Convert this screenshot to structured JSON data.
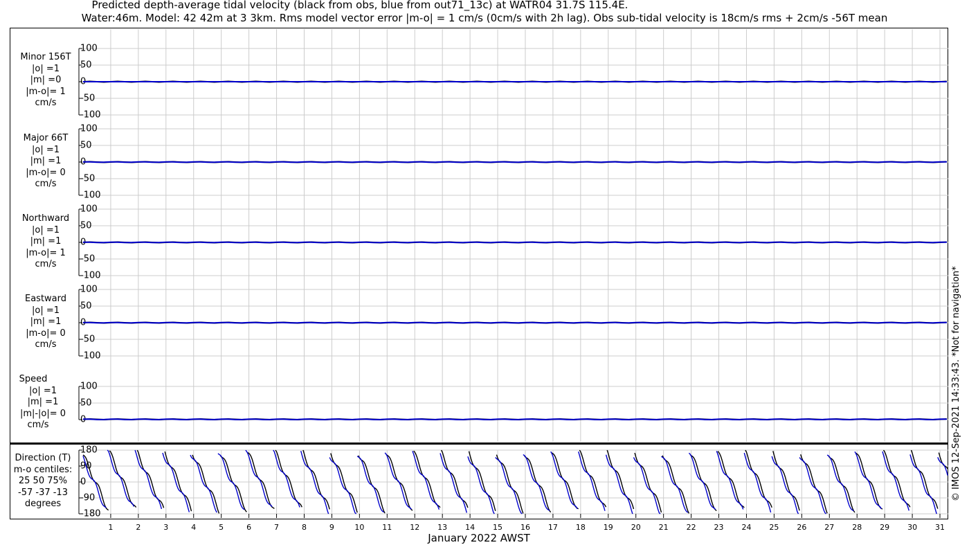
{
  "title_line1": "Predicted depth-average tidal velocity (black from obs, blue from out71_13c) at WATR04 31.7S 115.4E.",
  "title_line2": "Water:46m. Model: 42 42m at 3 3km. Rms model vector error |m-o| = 1 cm/s (0cm/s with 2h lag). Obs sub-tidal velocity is 18cm/s rms + 2cm/s -56T mean",
  "x_axis_label": "January 2022 AWST",
  "credit": "© IMOS 12-Sep-2021 14:33:43. *Not for navigation*",
  "colors": {
    "obs": "#000000",
    "model": "#0000cc",
    "grid": "#cccccc"
  },
  "panels": [
    {
      "key": "minor",
      "label_lines": [
        "Minor 156T",
        "|o| =1",
        "|m| =0",
        "|m-o|= 1",
        "cm/s"
      ]
    },
    {
      "key": "major",
      "label_lines": [
        "Major 66T",
        "|o| =1",
        "|m| =1",
        "|m-o|= 0",
        "cm/s"
      ]
    },
    {
      "key": "north",
      "label_lines": [
        "Northward",
        "|o| =1",
        "|m| =1",
        "|m-o|= 1",
        "cm/s"
      ]
    },
    {
      "key": "east",
      "label_lines": [
        "Eastward",
        "|o| =1",
        "|m| =1",
        "|m-o|= 0",
        "cm/s"
      ]
    },
    {
      "key": "speed",
      "label_lines": [
        "Speed",
        "|o| =1",
        "|m| =1",
        "|m|-|o|= 0",
        "cm/s"
      ]
    }
  ],
  "direction_panel": {
    "label_lines": [
      "Direction (T)",
      "m-o centiles:",
      "25  50  75%",
      "-57 -37 -13",
      "degrees"
    ]
  },
  "chart_data": [
    {
      "type": "line",
      "panel": "Minor 156T",
      "x_range_days": [
        0,
        31.3
      ],
      "ylim": [
        -100,
        100
      ],
      "yticks": [
        -100,
        -50,
        0,
        50,
        100
      ],
      "grid": true,
      "series": [
        {
          "name": "obs",
          "approx_value": 0,
          "amplitude": 1
        },
        {
          "name": "model",
          "approx_value": 0,
          "amplitude": 0
        }
      ]
    },
    {
      "type": "line",
      "panel": "Major 66T",
      "x_range_days": [
        0,
        31.3
      ],
      "ylim": [
        -100,
        100
      ],
      "yticks": [
        -100,
        -50,
        0,
        50,
        100
      ],
      "grid": true,
      "series": [
        {
          "name": "obs",
          "approx_value": 0,
          "amplitude": 1
        },
        {
          "name": "model",
          "approx_value": 0,
          "amplitude": 1
        }
      ]
    },
    {
      "type": "line",
      "panel": "Northward",
      "x_range_days": [
        0,
        31.3
      ],
      "ylim": [
        -100,
        100
      ],
      "yticks": [
        -100,
        -50,
        0,
        50,
        100
      ],
      "grid": true,
      "series": [
        {
          "name": "obs",
          "approx_value": 0,
          "amplitude": 1
        },
        {
          "name": "model",
          "approx_value": 0,
          "amplitude": 1
        }
      ]
    },
    {
      "type": "line",
      "panel": "Eastward",
      "x_range_days": [
        0,
        31.3
      ],
      "ylim": [
        -100,
        100
      ],
      "yticks": [
        -100,
        -50,
        0,
        50,
        100
      ],
      "grid": true,
      "series": [
        {
          "name": "obs",
          "approx_value": 0,
          "amplitude": 1
        },
        {
          "name": "model",
          "approx_value": 0,
          "amplitude": 1
        }
      ]
    },
    {
      "type": "line",
      "panel": "Speed",
      "x_range_days": [
        0,
        31.3
      ],
      "ylim": [
        0,
        100
      ],
      "yticks": [
        0,
        50,
        100
      ],
      "grid": true,
      "series": [
        {
          "name": "obs",
          "approx_value": 1,
          "amplitude": 1
        },
        {
          "name": "model",
          "approx_value": 1,
          "amplitude": 1
        }
      ]
    },
    {
      "type": "line",
      "panel": "Direction (T)",
      "x_range_days": [
        0,
        31.3
      ],
      "ylim": [
        -180,
        180
      ],
      "yticks": [
        -180,
        -90,
        0,
        90,
        180
      ],
      "grid": true,
      "x_tick_labels": [
        "1",
        "2",
        "3",
        "4",
        "5",
        "6",
        "7",
        "8",
        "9",
        "10",
        "11",
        "12",
        "13",
        "14",
        "15",
        "16",
        "17",
        "18",
        "19",
        "20",
        "21",
        "22",
        "23",
        "24",
        "25",
        "26",
        "27",
        "28",
        "29",
        "30",
        "31"
      ],
      "series": [
        {
          "name": "obs",
          "pattern": "sawtooth",
          "cycles_per_day": 1,
          "range": [
            -180,
            180
          ]
        },
        {
          "name": "model",
          "pattern": "sawtooth",
          "cycles_per_day": 1,
          "range": [
            -180,
            180
          ]
        }
      ]
    }
  ]
}
